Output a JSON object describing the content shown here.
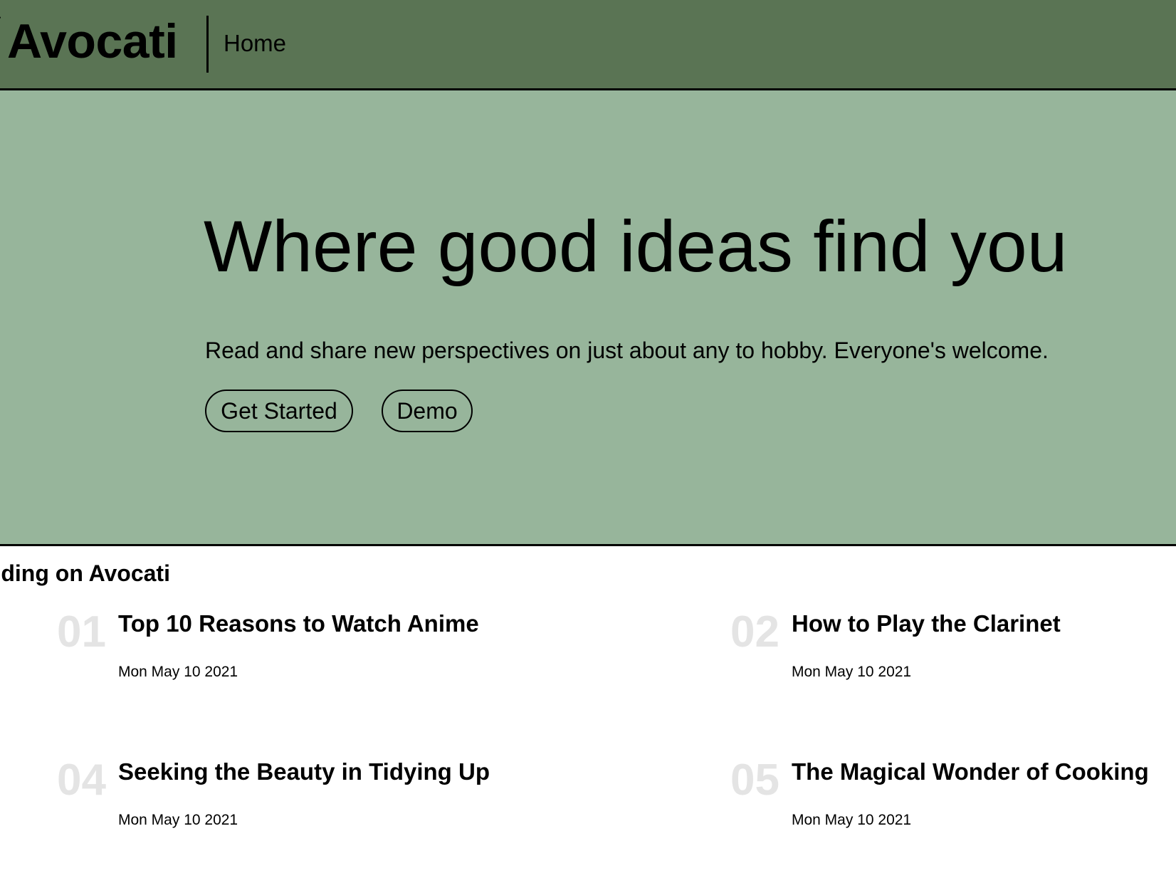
{
  "navbar": {
    "logo_mark": "ʃ",
    "logo": "Avocati",
    "home_link": "Home",
    "background_color": "#5a7454"
  },
  "hero": {
    "title": "Where good ideas find you",
    "subtitle": "Read and share new perspectives on just about any to hobby. Everyone's welcome.",
    "get_started_label": "Get Started",
    "demo_label": "Demo",
    "background_color": "#97b59b"
  },
  "trending": {
    "heading": "Trending on Avocati",
    "visible_heading": "ending on Avocati",
    "articles": [
      {
        "number": "01",
        "title": "Top 10 Reasons to Watch Anime",
        "date": "Mon May 10 2021"
      },
      {
        "number": "02",
        "title": "How to Play the Clarinet",
        "date": "Mon May 10 2021"
      },
      {
        "number": "04",
        "title": "Seeking the Beauty in Tidying Up",
        "date": "Mon May 10 2021"
      },
      {
        "number": "05",
        "title": "The Magical Wonder of Cooking",
        "date": "Mon May 10 2021"
      }
    ],
    "number_color": "#e4e4e4"
  }
}
